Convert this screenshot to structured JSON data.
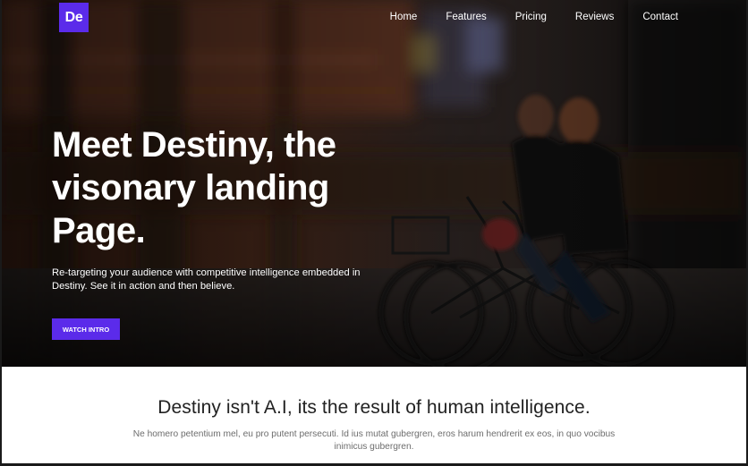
{
  "header": {
    "logo": "De",
    "nav": [
      "Home",
      "Features",
      "Pricing",
      "Reviews",
      "Contact"
    ]
  },
  "hero": {
    "headline_lines": [
      "Meet Destiny, the",
      "visonary landing",
      "Page."
    ],
    "subtext": "Re-targeting your audience with competitive intelligence embedded in Destiny. See it in action and then believe.",
    "cta_label": "WATCH INTRO"
  },
  "intro": {
    "title": "Destiny isn't A.I, its the result of human intelligence.",
    "text": "Ne homero petentium mel, eu pro putent persecuti. Id ius mutat gubergren, eros harum hendrerit ex eos, in quo vocibus inimicus gubergren."
  },
  "colors": {
    "accent": "#5b2bea",
    "hero_text": "#ffffff",
    "title_text": "#222222",
    "body_text": "#6d6d6d"
  }
}
